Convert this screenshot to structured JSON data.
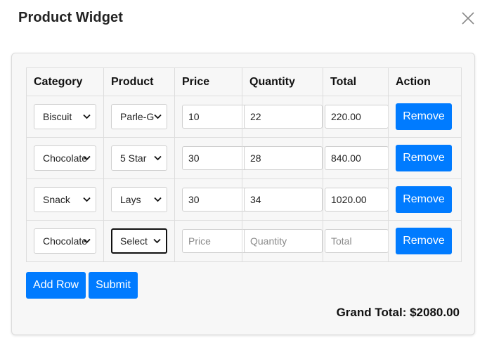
{
  "modal": {
    "title": "Product Widget"
  },
  "table": {
    "headers": [
      "Category",
      "Product",
      "Price",
      "Quantity",
      "Total",
      "Action"
    ],
    "rows": [
      {
        "category": "Biscuit",
        "product": "Parle-G",
        "price": "10",
        "quantity": "22",
        "total": "220.00",
        "action": "Remove"
      },
      {
        "category": "Chocolate",
        "product": "5 Star",
        "price": "30",
        "quantity": "28",
        "total": "840.00",
        "action": "Remove"
      },
      {
        "category": "Snack",
        "product": "Lays",
        "price": "30",
        "quantity": "34",
        "total": "1020.00",
        "action": "Remove"
      },
      {
        "category": "Chocolate",
        "product": "Select",
        "price": "",
        "quantity": "",
        "total": "",
        "action": "Remove"
      }
    ],
    "placeholders": {
      "price": "Price",
      "quantity": "Quantity",
      "total": "Total"
    }
  },
  "footer": {
    "add_row_label": "Add Row",
    "submit_label": "Submit",
    "grand_total_label": "Grand Total: $2080.00"
  },
  "colors": {
    "primary": "#007bff",
    "card_bg": "#f7f7f7"
  },
  "icons": {
    "close": "close-icon",
    "dropdown": "chevron-down-icon"
  }
}
